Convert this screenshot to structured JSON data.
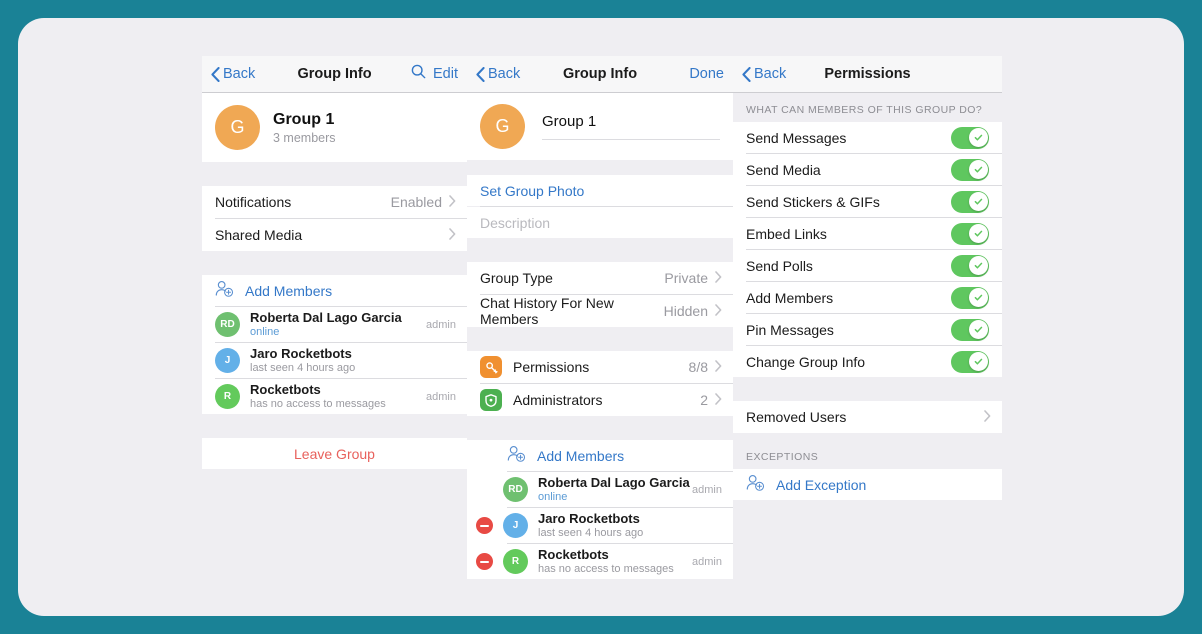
{
  "panels": {
    "left": {
      "nav": {
        "back": "Back",
        "title": "Group Info",
        "edit": "Edit",
        "search_icon": "search-icon"
      },
      "group": {
        "avatar_letter": "G",
        "avatar_color": "#f0a854",
        "name": "Group 1",
        "members_count": "3 members"
      },
      "rows": [
        {
          "label": "Notifications",
          "value": "Enabled"
        },
        {
          "label": "Shared Media",
          "value": ""
        }
      ],
      "add_members": "Add Members",
      "members": [
        {
          "initials": "RD",
          "color": "#6fc070",
          "name": "Roberta Dal Lago Garcia",
          "status": "online",
          "status_type": "online",
          "badge": "admin"
        },
        {
          "initials": "J",
          "color": "#63b0e8",
          "name": "Jaro Rocketbots",
          "status": "last seen 4 hours ago",
          "status_type": "normal",
          "badge": ""
        },
        {
          "initials": "R",
          "color": "#63ca5c",
          "name": "Rocketbots",
          "status": "has no access to messages",
          "status_type": "normal",
          "badge": "admin"
        }
      ],
      "leave_group": "Leave Group"
    },
    "middle": {
      "nav": {
        "back": "Back",
        "title": "Group Info",
        "done": "Done"
      },
      "group": {
        "avatar_letter": "G",
        "avatar_color": "#f0a854",
        "name": "Group 1"
      },
      "set_group_photo": "Set Group Photo",
      "description_placeholder": "Description",
      "rows": [
        {
          "label": "Group Type",
          "value": "Private"
        },
        {
          "label": "Chat History For New Members",
          "value": "Hidden"
        }
      ],
      "manage": [
        {
          "label": "Permissions",
          "value": "8/8",
          "icon": "key-icon",
          "tile": "tile-orange"
        },
        {
          "label": "Administrators",
          "value": "2",
          "icon": "shield-icon",
          "tile": "tile-green"
        }
      ],
      "add_members": "Add Members",
      "members": [
        {
          "initials": "RD",
          "color": "#6fc070",
          "name": "Roberta Dal Lago Garcia",
          "status": "online",
          "status_type": "online",
          "badge": "admin",
          "removable": false
        },
        {
          "initials": "J",
          "color": "#63b0e8",
          "name": "Jaro Rocketbots",
          "status": "last seen 4 hours ago",
          "status_type": "normal",
          "badge": "",
          "removable": true
        },
        {
          "initials": "R",
          "color": "#63ca5c",
          "name": "Rocketbots",
          "status": "has no access to messages",
          "status_type": "normal",
          "badge": "admin",
          "removable": true
        }
      ]
    },
    "right": {
      "nav": {
        "back": "Back",
        "title": "Permissions"
      },
      "section_title": "WHAT CAN MEMBERS OF THIS GROUP DO?",
      "permissions": [
        {
          "label": "Send Messages",
          "enabled": true
        },
        {
          "label": "Send Media",
          "enabled": true
        },
        {
          "label": "Send Stickers & GIFs",
          "enabled": true
        },
        {
          "label": "Embed Links",
          "enabled": true
        },
        {
          "label": "Send Polls",
          "enabled": true
        },
        {
          "label": "Add Members",
          "enabled": true
        },
        {
          "label": "Pin Messages",
          "enabled": true
        },
        {
          "label": "Change Group Info",
          "enabled": true
        }
      ],
      "removed_users": "Removed Users",
      "exceptions_title": "EXCEPTIONS",
      "add_exception": "Add Exception"
    }
  },
  "theme": {
    "background": "#1a8296",
    "panel_background": "#efeef2",
    "card": "#ffffff",
    "accent_blue": "#3478c8",
    "toggle_on": "#5fc75f",
    "destructive": "#e8615c",
    "remove_button": "#e84a44"
  }
}
